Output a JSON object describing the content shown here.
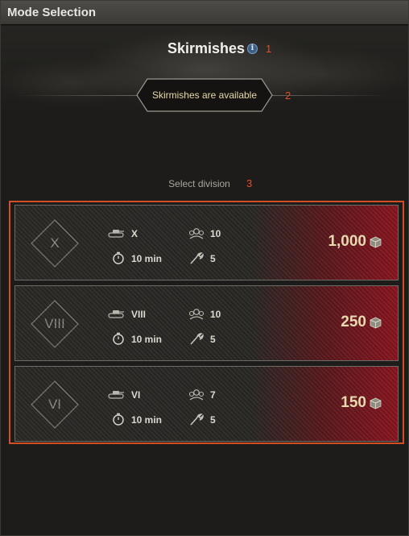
{
  "window": {
    "title": "Mode Selection"
  },
  "header": {
    "mode_title": "Skirmishes",
    "status_text": "Skirmishes are available",
    "select_label": "Select division",
    "markers": [
      "1",
      "2",
      "3"
    ]
  },
  "divisions": [
    {
      "tier": "X",
      "vehicle_tier": "X",
      "players": "10",
      "duration": "10 min",
      "count": "5",
      "reward": "1,000"
    },
    {
      "tier": "VIII",
      "vehicle_tier": "VIII",
      "players": "10",
      "duration": "10 min",
      "count": "5",
      "reward": "250"
    },
    {
      "tier": "VI",
      "vehicle_tier": "VI",
      "players": "7",
      "duration": "10 min",
      "count": "5",
      "reward": "150"
    }
  ],
  "colors": {
    "accent": "#d24e24",
    "reward_bg": "#8c1620"
  },
  "icons": [
    "info-icon",
    "tank-icon",
    "stopwatch-icon",
    "players-icon",
    "wrench-icon",
    "supply-box-icon"
  ]
}
